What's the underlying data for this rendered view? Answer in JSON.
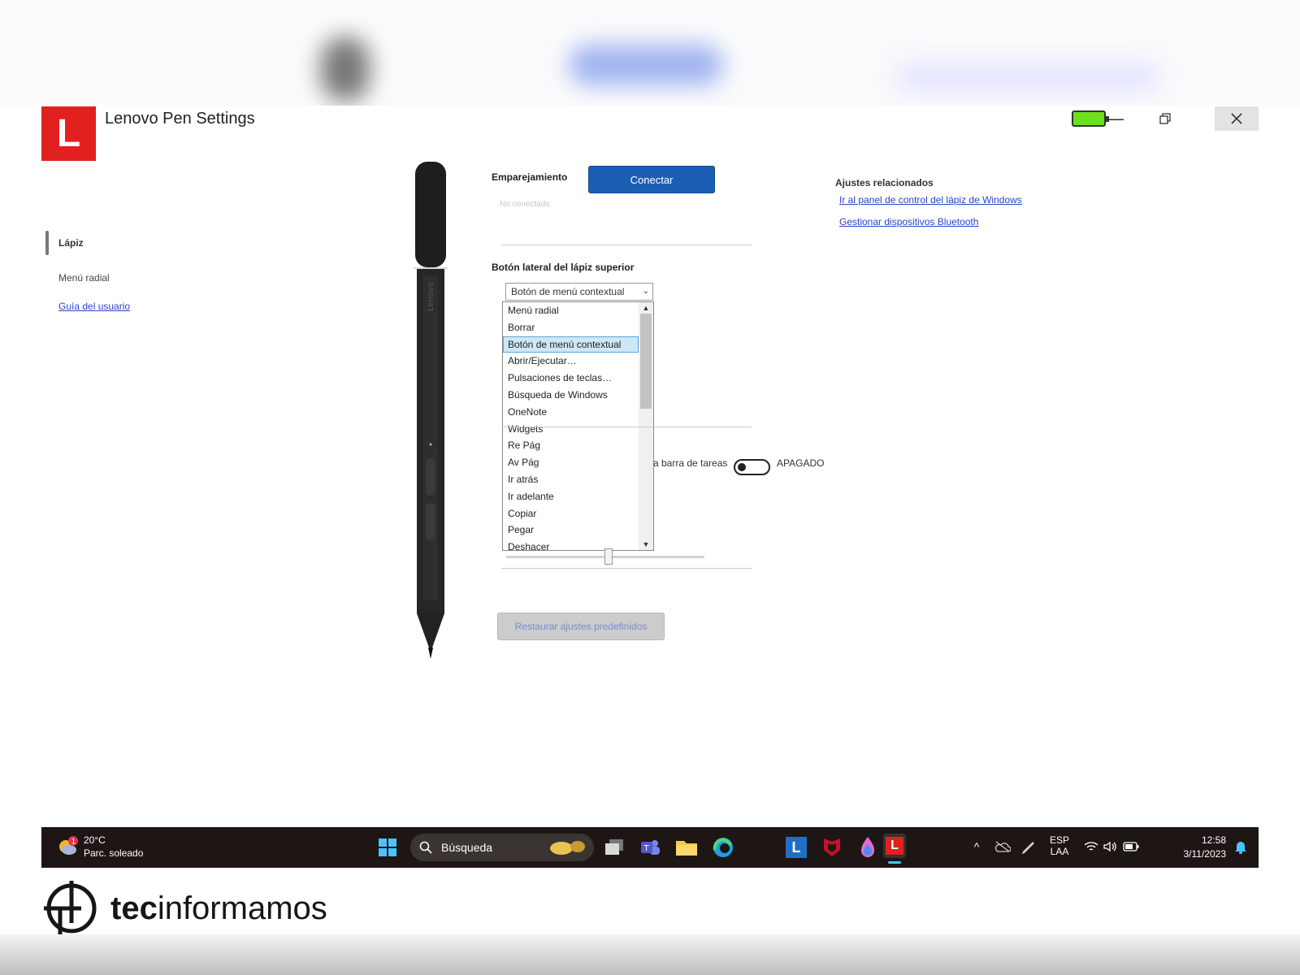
{
  "window": {
    "title": "Lenovo Pen Settings",
    "logo_letter": "L"
  },
  "sidebar": {
    "items": [
      {
        "label": "Lápiz"
      },
      {
        "label": "Menú radial"
      },
      {
        "label": "Guía del usuario"
      }
    ]
  },
  "pen": {
    "brand": "Lenovo"
  },
  "pairing": {
    "label": "Emparejamiento",
    "button": "Conectar",
    "status": "No conectado"
  },
  "side_button": {
    "label": "Botón lateral del lápiz superior",
    "selected": "Botón de menú contextual",
    "options": [
      "Menú radial",
      "Borrar",
      "Botón de menú contextual",
      "Abrir/Ejecutar…",
      "Pulsaciones de teclas…",
      "Búsqueda de Windows",
      "OneNote",
      "Widgets",
      "Re Pág",
      "Av Pág",
      "Ir atrás",
      "Ir adelante",
      "Copiar",
      "Pegar",
      "Deshacer"
    ]
  },
  "taskbar_toggle": {
    "label_fragment": "a barra de tareas",
    "state": "APAGADO"
  },
  "restore_button": "Restaurar ajustes predefinidos",
  "related": {
    "title": "Ajustes relacionados",
    "links": [
      "Ir al panel de control del lápiz de Windows",
      "Gestionar dispositivos Bluetooth"
    ]
  },
  "taskbar": {
    "weather_temp": "20°C",
    "weather_desc": "Parc. soleado",
    "weather_badge": "1",
    "search": "Búsqueda",
    "lang_1": "ESP",
    "lang_2": "LAA",
    "time": "12:58",
    "date": "3/11/2023"
  },
  "watermark": {
    "bold": "tec",
    "rest": "informamos"
  },
  "colors": {
    "accent": "#1a5fb4",
    "logo": "#e1211f",
    "battery": "#6fe020",
    "taskbar": "#1d1614"
  }
}
